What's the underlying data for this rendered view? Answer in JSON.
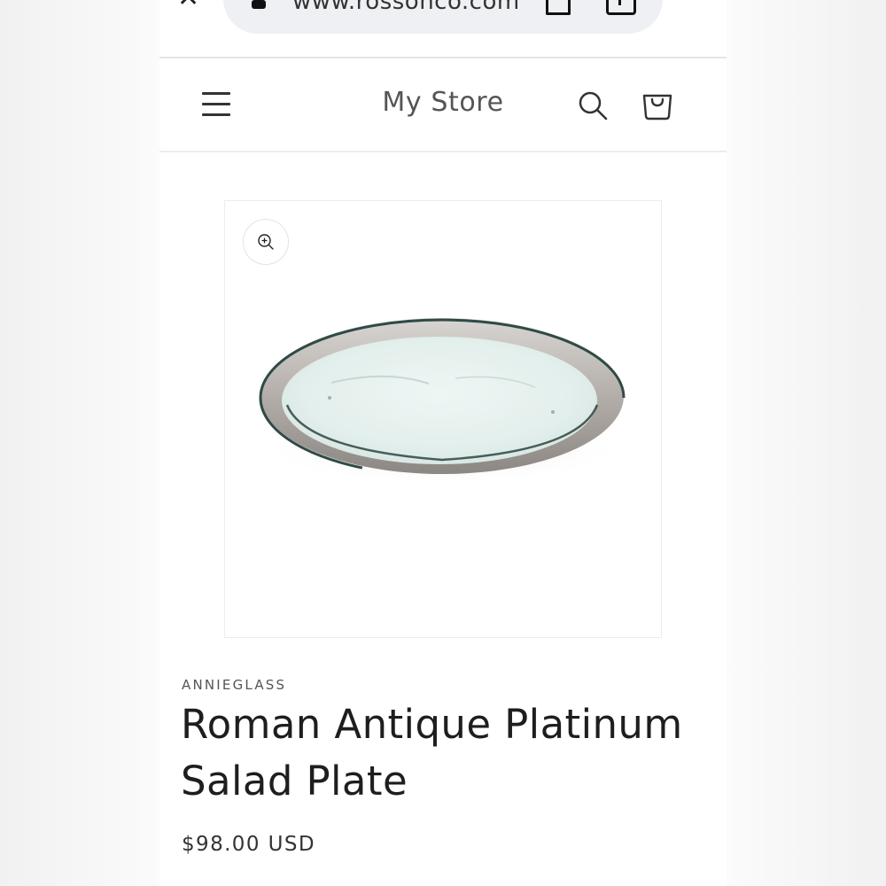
{
  "browser": {
    "url": "www.rossonco.com"
  },
  "header": {
    "store_name": "My Store"
  },
  "product": {
    "vendor": "ANNIEGLASS",
    "title": "Roman Antique Platinum Salad Plate",
    "price": "$98.00 USD"
  },
  "icons": {
    "close": "close-icon",
    "lock": "lock-icon",
    "bookmark": "bookmark-icon",
    "share": "share-icon",
    "menu": "hamburger-menu-icon",
    "search": "search-icon",
    "cart": "cart-icon",
    "zoom": "zoom-in-icon"
  }
}
